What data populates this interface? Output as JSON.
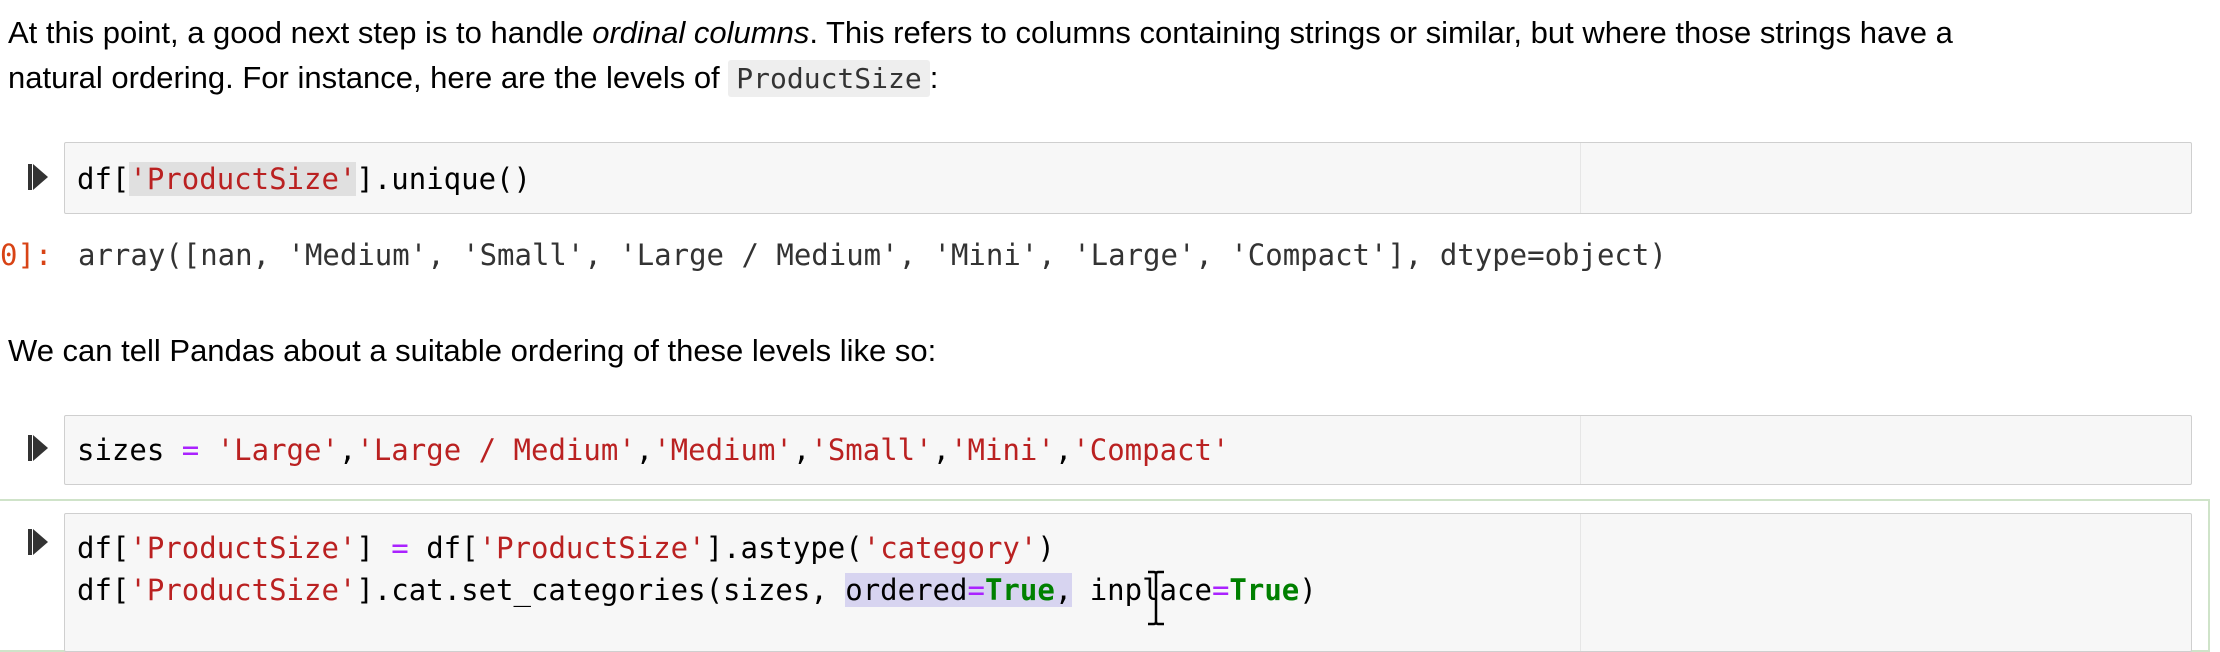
{
  "markdown": {
    "para1_line1_before": "At this point, a good next step is to handle ",
    "para1_line1_em": "ordinal columns",
    "para1_line1_after": ". This refers to columns containing strings or similar, but where those strings have a",
    "para1_line2_before": "natural ordering. For instance, here are the levels of ",
    "para1_line2_code": "ProductSize",
    "para1_line2_after": ":",
    "para2": "We can tell Pandas about a suitable ordering of these levels like so:"
  },
  "cell1": {
    "df": "df[",
    "str1": "'ProductSize'",
    "rest": "].unique()"
  },
  "output1": {
    "prompt": "0]:",
    "text": "array([nan, 'Medium', 'Small', 'Large / Medium', 'Mini', 'Large', 'Compact'], dtype=object)"
  },
  "cell2": {
    "var": "sizes ",
    "eq": "=",
    "sp": " ",
    "s1": "'Large'",
    "c1": ",",
    "s2": "'Large / Medium'",
    "c2": ",",
    "s3": "'Medium'",
    "c3": ",",
    "s4": "'Small'",
    "c4": ",",
    "s5": "'Mini'",
    "c5": ",",
    "s6": "'Compact'"
  },
  "cell3": {
    "l1_a": "df[",
    "l1_s1": "'ProductSize'",
    "l1_b": "] ",
    "l1_eq": "=",
    "l1_c": " df[",
    "l1_s2": "'ProductSize'",
    "l1_d": "].astype(",
    "l1_s3": "'category'",
    "l1_e": ")",
    "l2_a": "df[",
    "l2_s1": "'ProductSize'",
    "l2_b": "].cat.set_categories(sizes, ",
    "l2_kw1": "ordered",
    "l2_eq1": "=",
    "l2_true1": "True",
    "l2_comma": ",",
    "l2_sp": " ",
    "l2_kw2": "inplace",
    "l2_eq2": "=",
    "l2_true2": "True",
    "l2_end": ")"
  },
  "icons": {
    "run": "run-cell-icon",
    "cursor": "text-cursor-icon"
  },
  "colors": {
    "string": "#ba2121",
    "operator": "#aa22ff",
    "keyword": "#008000",
    "output_prompt": "#d84315"
  }
}
